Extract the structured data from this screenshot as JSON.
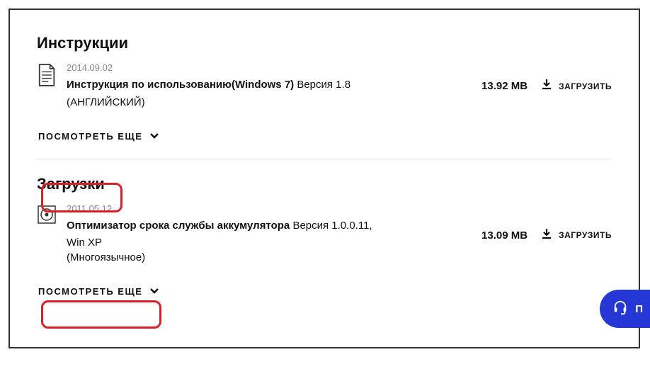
{
  "sections": {
    "instructions": {
      "title": "Инструкции",
      "item": {
        "date": "2014.09.02",
        "name": "Инструкция по использованию(Windows 7)",
        "version": "Версия 1.8",
        "lang": "(АНГЛИЙСКИЙ)",
        "size": "13.92 MB",
        "download_label": "ЗАГРУЗИТЬ"
      },
      "view_more": "ПОСМОТРЕТЬ ЕЩЕ"
    },
    "downloads": {
      "title": "Загрузки",
      "item": {
        "date": "2011.05.12",
        "name": "Оптимизатор срока службы аккумулятора",
        "version": "Версия 1.0.0.11,",
        "os": "Win XP",
        "lang": "(Многоязычное)",
        "size": "13.09 MB",
        "download_label": "ЗАГРУЗИТЬ"
      },
      "view_more": "ПОСМОТРЕТЬ ЕЩЕ"
    }
  },
  "support_fab": "П"
}
